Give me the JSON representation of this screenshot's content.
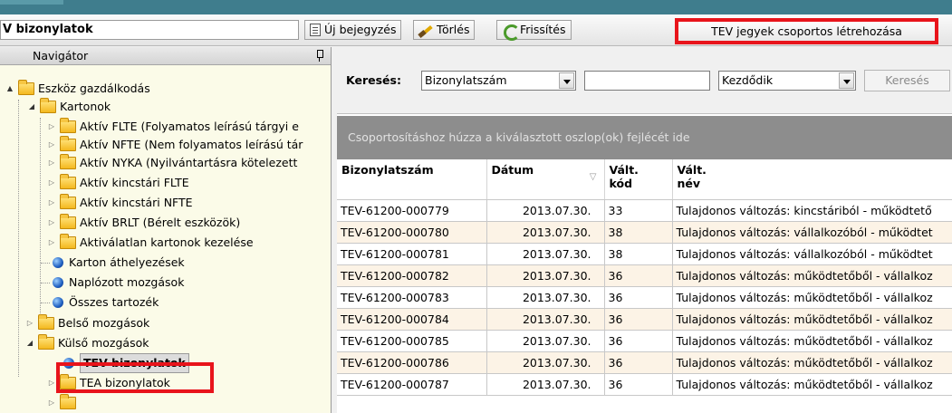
{
  "toolbar": {
    "title": "V bizonylatok",
    "new_label": "Új bejegyzés",
    "delete_label": "Törlés",
    "refresh_label": "Frissítés",
    "group_create_label": "TEV jegyek csoportos létrehozása"
  },
  "navigator": {
    "title": "Navigátor",
    "items": [
      {
        "label": "Eszköz gazdálkodás"
      },
      {
        "label": "Kartonok"
      },
      {
        "label": "Aktív FLTE (Folyamatos leírású tárgyi e"
      },
      {
        "label": "Aktív NFTE (Nem folyamatos leírású tár"
      },
      {
        "label": "Aktív NYKA (Nyilvántartásra kötelezett"
      },
      {
        "label": "Aktív kincstári FLTE"
      },
      {
        "label": "Aktív kincstári NFTE"
      },
      {
        "label": "Aktív BRLT (Bérelt eszközök)"
      },
      {
        "label": "Aktiválatlan kartonok kezelése"
      },
      {
        "label": "Karton áthelyezések"
      },
      {
        "label": "Naplózott mozgások"
      },
      {
        "label": "Összes tartozék"
      },
      {
        "label": "Belső mozgások"
      },
      {
        "label": "Külső mozgások"
      },
      {
        "label": "TEV bizonylatok"
      },
      {
        "label": "TEA bizonylatok"
      }
    ]
  },
  "search": {
    "label": "Keresés:",
    "field_value": "Bizonylatszám",
    "text_value": "",
    "mode_value": "Kezdődik",
    "button_label": "Keresés"
  },
  "grid": {
    "group_hint": "Csoportosításhoz húzza a kiválasztott oszlop(ok) fejlécét ide",
    "columns": {
      "doc_no": "Bizonylatszám",
      "date": "Dátum",
      "code_1": "Vált.",
      "code_2": "kód",
      "name_1": "Vált.",
      "name_2": "név"
    },
    "sort_indicator": "▽",
    "rows": [
      {
        "doc_no": "TEV-61200-000779",
        "date": "2013.07.30.",
        "code": "33",
        "name": "Tulajdonos változás: kincstáriból - működtető"
      },
      {
        "doc_no": "TEV-61200-000780",
        "date": "2013.07.30.",
        "code": "38",
        "name": "Tulajdonos változás: vállalkozóból - működtet"
      },
      {
        "doc_no": "TEV-61200-000781",
        "date": "2013.07.30.",
        "code": "38",
        "name": "Tulajdonos változás: vállalkozóból - működtet"
      },
      {
        "doc_no": "TEV-61200-000782",
        "date": "2013.07.30.",
        "code": "36",
        "name": "Tulajdonos változás: működtetőből - vállalkoz"
      },
      {
        "doc_no": "TEV-61200-000783",
        "date": "2013.07.30.",
        "code": "36",
        "name": "Tulajdonos változás: működtetőből - vállalkoz"
      },
      {
        "doc_no": "TEV-61200-000784",
        "date": "2013.07.30.",
        "code": "36",
        "name": "Tulajdonos változás: működtetőből - vállalkoz"
      },
      {
        "doc_no": "TEV-61200-000785",
        "date": "2013.07.30.",
        "code": "36",
        "name": "Tulajdonos változás: működtetőből - vállalkoz"
      },
      {
        "doc_no": "TEV-61200-000786",
        "date": "2013.07.30.",
        "code": "36",
        "name": "Tulajdonos változás: működtetőből - vállalkoz"
      },
      {
        "doc_no": "TEV-61200-000787",
        "date": "2013.07.30.",
        "code": "36",
        "name": "Tulajdonos változás: működtetőből - vállalkoz"
      }
    ]
  },
  "colors": {
    "highlight": "#e8141b",
    "row_alt": "#fcf3e6",
    "group_bar": "#8d8d8d",
    "top_strip": "#3f7d8d"
  }
}
